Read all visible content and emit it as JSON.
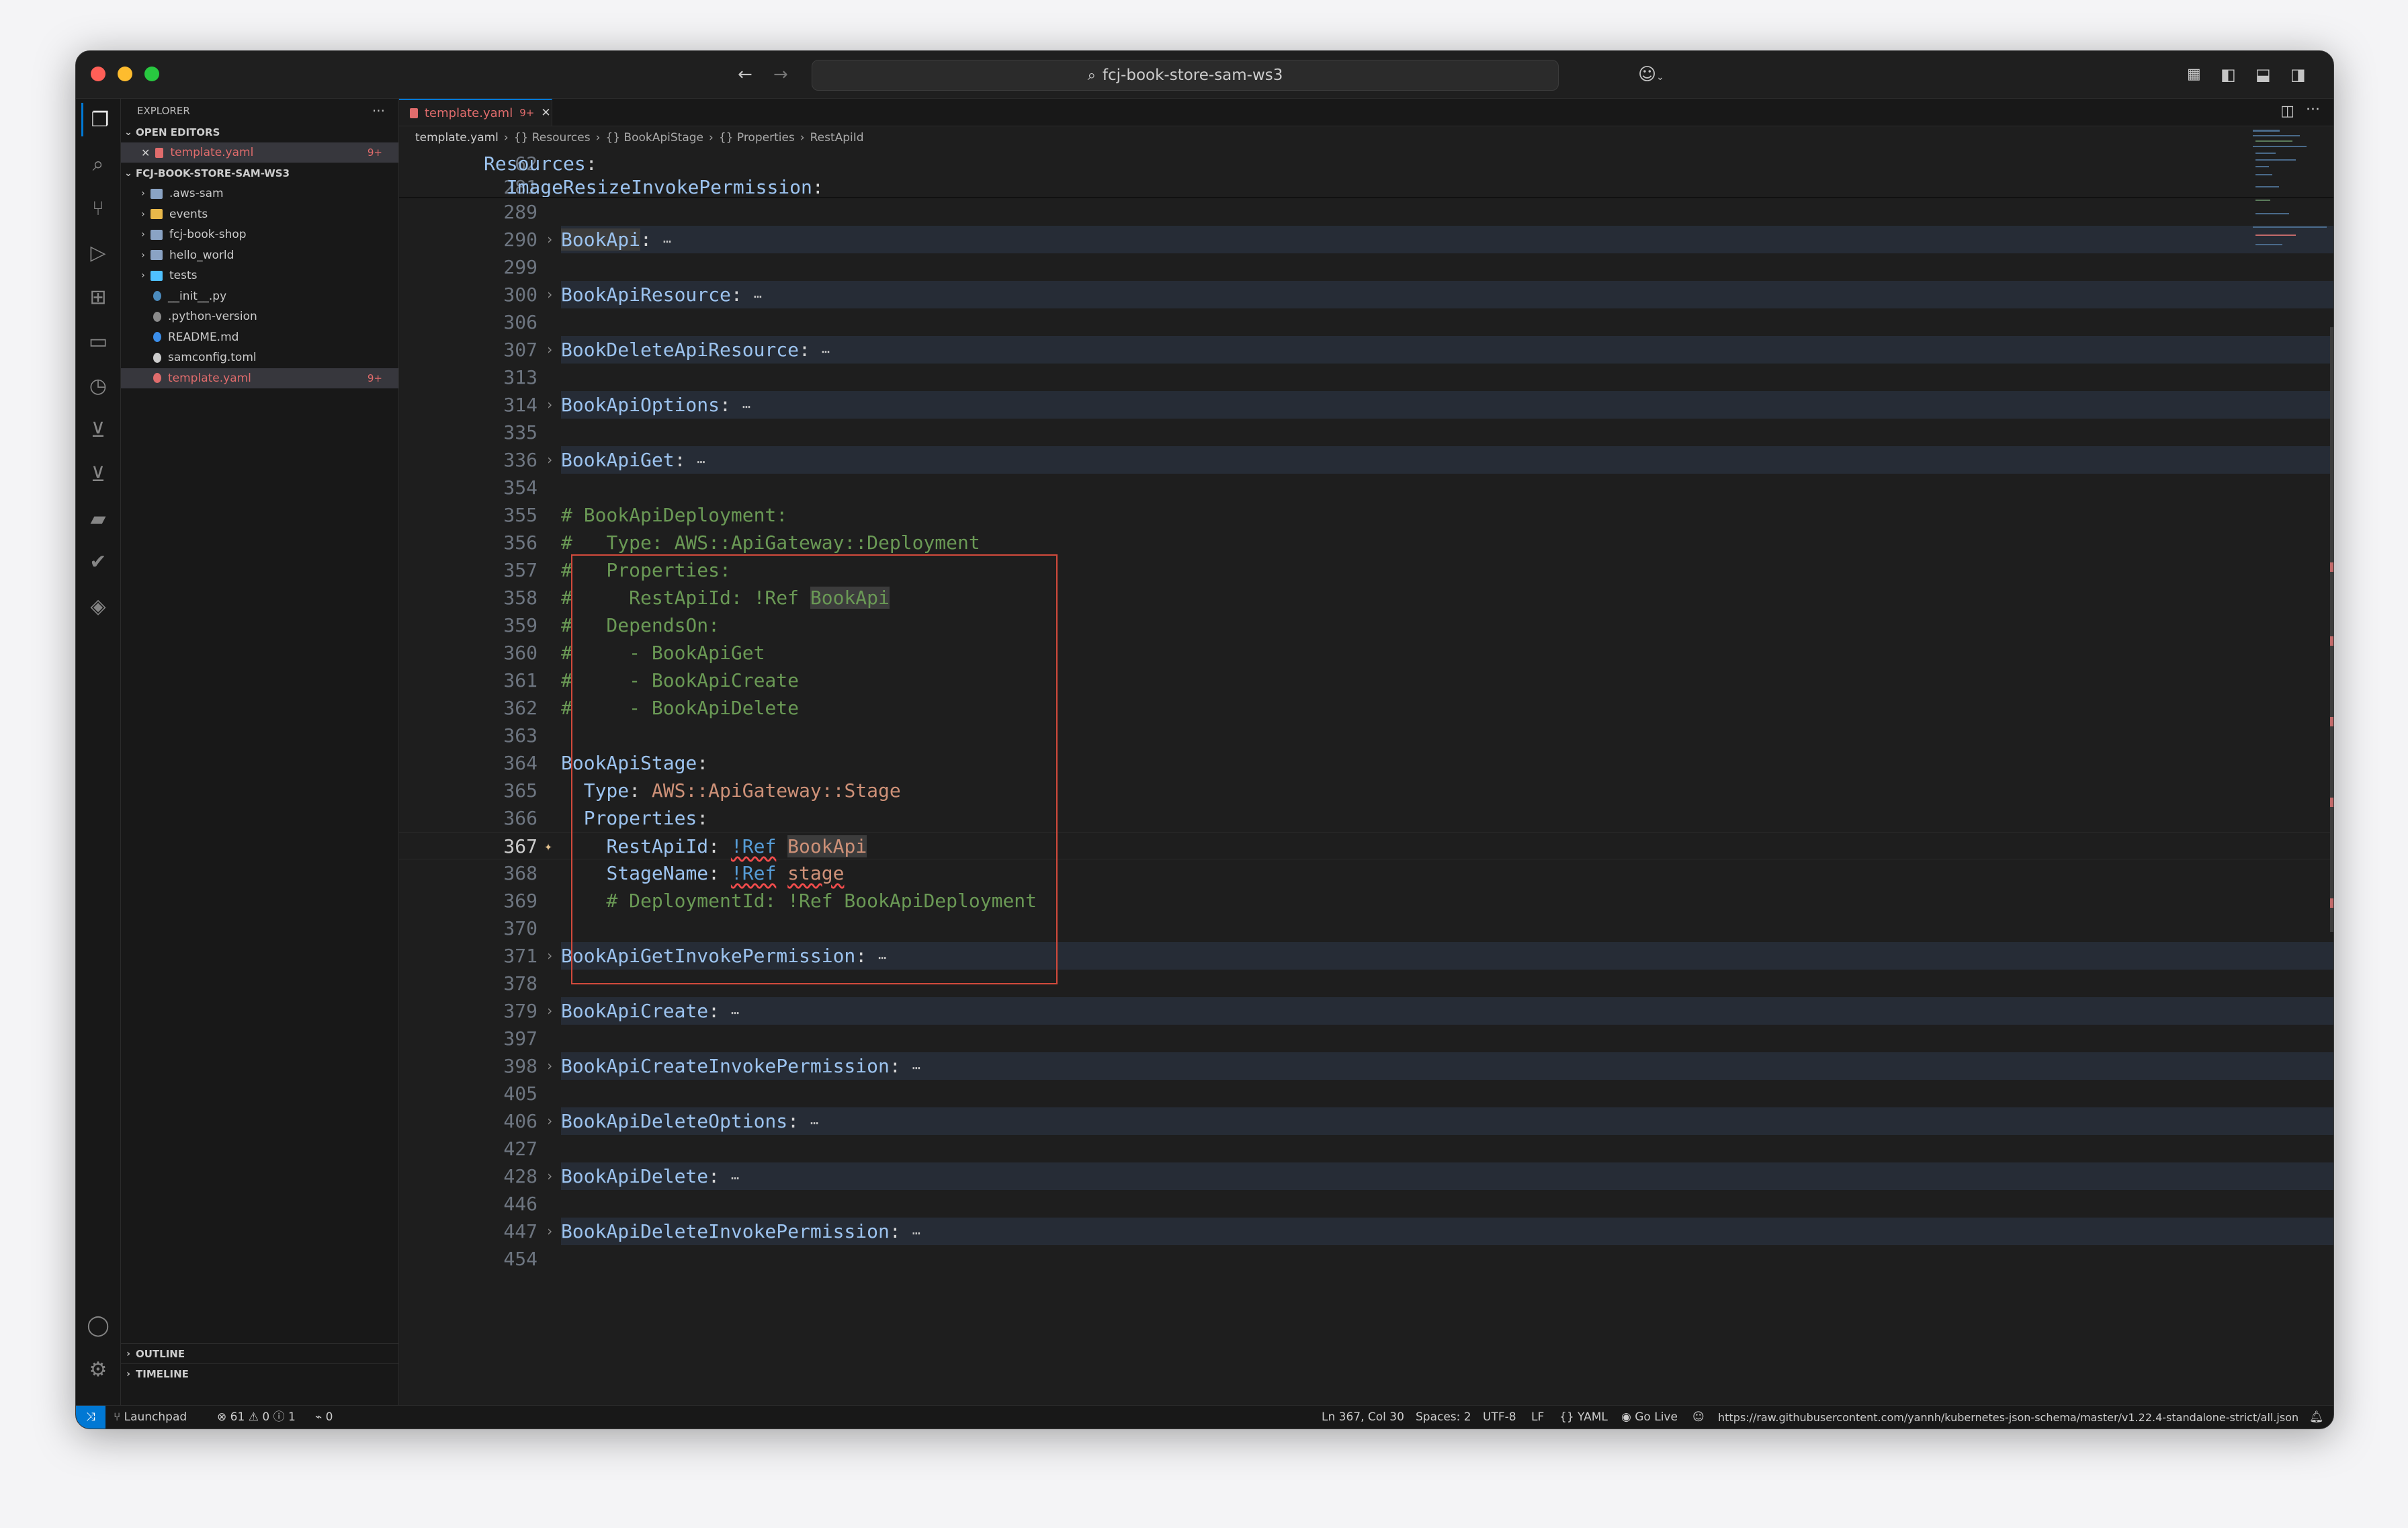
{
  "window": {
    "search_text": "fcj-book-store-sam-ws3"
  },
  "sidebar": {
    "title": "EXPLORER",
    "open_editors_label": "OPEN EDITORS",
    "open_editor_file": "template.yaml",
    "open_editor_badge": "9+",
    "project_label": "FCJ-BOOK-STORE-SAM-WS3",
    "tree": [
      {
        "name": ".aws-sam",
        "type": "folder",
        "color": "#8aa3c4"
      },
      {
        "name": "events",
        "type": "folder",
        "color": "#e8b84a"
      },
      {
        "name": "fcj-book-shop",
        "type": "folder",
        "color": "#8aa3c4"
      },
      {
        "name": "hello_world",
        "type": "folder",
        "color": "#8aa3c4"
      },
      {
        "name": "tests",
        "type": "folder",
        "color": "#4fc1ff"
      },
      {
        "name": "__init__.py",
        "type": "python",
        "color": "#4b8bbe"
      },
      {
        "name": ".python-version",
        "type": "file",
        "color": "#8b8b8b"
      },
      {
        "name": "README.md",
        "type": "info",
        "color": "#3b8eea"
      },
      {
        "name": "samconfig.toml",
        "type": "toml",
        "color": "#cccccc"
      },
      {
        "name": "template.yaml",
        "type": "yaml",
        "color": "#e06c6c",
        "badge": "9+"
      }
    ],
    "outline_label": "OUTLINE",
    "timeline_label": "TIMELINE"
  },
  "editor": {
    "tab_label": "template.yaml",
    "tab_badge": "9+",
    "breadcrumb": [
      "template.yaml",
      "{} Resources",
      "{} BookApiStage",
      "{} Properties",
      "RestApiId"
    ],
    "sticky": [
      {
        "n": "62",
        "text": "Resources:"
      },
      {
        "n": "281",
        "text": "  ImageResizeInvokePermission:"
      }
    ],
    "lines": [
      {
        "n": "289",
        "text": ""
      },
      {
        "n": "290",
        "text": "BookApi:",
        "folded": true
      },
      {
        "n": "299",
        "text": ""
      },
      {
        "n": "300",
        "text": "BookApiResource:",
        "folded": true
      },
      {
        "n": "306",
        "text": ""
      },
      {
        "n": "307",
        "text": "BookDeleteApiResource:",
        "folded": true
      },
      {
        "n": "313",
        "text": ""
      },
      {
        "n": "314",
        "text": "BookApiOptions:",
        "folded": true
      },
      {
        "n": "335",
        "text": ""
      },
      {
        "n": "336",
        "text": "BookApiGet:",
        "folded": true
      },
      {
        "n": "354",
        "text": ""
      },
      {
        "n": "355",
        "text": "# BookApiDeployment:"
      },
      {
        "n": "356",
        "text": "#   Type: AWS::ApiGateway::Deployment"
      },
      {
        "n": "357",
        "text": "#   Properties:"
      },
      {
        "n": "358",
        "text": "#     RestApiId: !Ref BookApi"
      },
      {
        "n": "359",
        "text": "#   DependsOn:"
      },
      {
        "n": "360",
        "text": "#     - BookApiGet"
      },
      {
        "n": "361",
        "text": "#     - BookApiCreate"
      },
      {
        "n": "362",
        "text": "#     - BookApiDelete"
      },
      {
        "n": "363",
        "text": ""
      },
      {
        "n": "364",
        "text": "BookApiStage:"
      },
      {
        "n": "365",
        "text": "  Type: AWS::ApiGateway::Stage"
      },
      {
        "n": "366",
        "text": "  Properties:"
      },
      {
        "n": "367",
        "text": "    RestApiId: !Ref BookApi"
      },
      {
        "n": "368",
        "text": "    StageName: !Ref stage"
      },
      {
        "n": "369",
        "text": "    # DeploymentId: !Ref BookApiDeployment"
      },
      {
        "n": "370",
        "text": ""
      },
      {
        "n": "371",
        "text": "BookApiGetInvokePermission:",
        "folded": true
      },
      {
        "n": "378",
        "text": ""
      },
      {
        "n": "379",
        "text": "BookApiCreate:",
        "folded": true
      },
      {
        "n": "397",
        "text": ""
      },
      {
        "n": "398",
        "text": "BookApiCreateInvokePermission:",
        "folded": true
      },
      {
        "n": "405",
        "text": ""
      },
      {
        "n": "406",
        "text": "BookApiDeleteOptions:",
        "folded": true
      },
      {
        "n": "427",
        "text": ""
      },
      {
        "n": "428",
        "text": "BookApiDelete:",
        "folded": true
      },
      {
        "n": "446",
        "text": ""
      },
      {
        "n": "447",
        "text": "BookApiDeleteInvokePermission:",
        "folded": true
      },
      {
        "n": "454",
        "text": ""
      }
    ]
  },
  "statusbar": {
    "remote": "Launchpad",
    "errors": "61",
    "warnings": "0",
    "infos": "1",
    "ports": "0",
    "position": "Ln 367, Col 30",
    "spaces": "Spaces: 2",
    "encoding": "UTF-8",
    "eol": "LF",
    "language": "YAML",
    "golive": "Go Live",
    "schema": "https://raw.githubusercontent.com/yannh/kubernetes-json-schema/master/v1.22.4-standalone-strict/all.json"
  },
  "colors": {
    "accent": "#0078d4",
    "highlight_box": "#d24a3c",
    "key": "#9cc3ef",
    "comment": "#6a9955",
    "value": "#ce9178"
  }
}
